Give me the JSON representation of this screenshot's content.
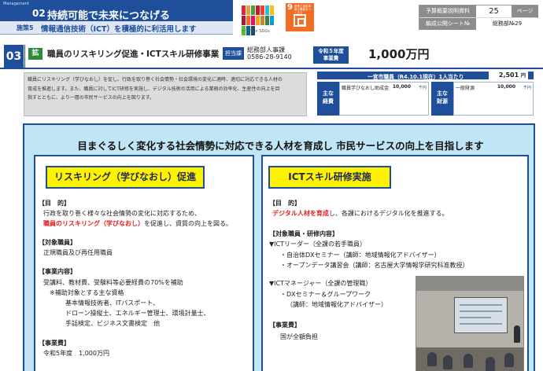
{
  "header": {
    "mgmt_label": "Management",
    "section_no": "02",
    "section_title": "持続可能で未来につなげる",
    "policy_no": "施策5",
    "policy_title": "情報通信技術（ICT）を積極的に利活用します",
    "sdgs_caption": "一宮市 × SDGs",
    "sdg_goal_no": "9",
    "sdg_goal_caption": "産業と技術革新の基盤をつくろう",
    "ref_label_1": "予算概要説明資料",
    "ref_page": "25",
    "ref_page_label": "ページ",
    "ref_label_2": "編成公開シート№",
    "ref_sheet": "総務部№29",
    "sdg_colors": [
      "#e5243b",
      "#dda63a",
      "#4c9f38",
      "#c5192d",
      "#ff3a21",
      "#26bde2",
      "#fcc30b",
      "#a21942",
      "#fd6925",
      "#dd1367",
      "#fd9d24",
      "#bf8b2e",
      "#3f7e44",
      "#0a97d9",
      "#56c02b",
      "#00689d",
      "#19486a"
    ]
  },
  "project": {
    "number": "03",
    "badge": "拡",
    "title": "職員のリスキリング促進・ICTスキル研修事業",
    "dept_label": "担当課",
    "dept_name": "総務部人事課",
    "dept_phone": "0586-28-9140",
    "fy_label_1": "令和５年度",
    "fy_label_2": "事業費",
    "budget": "1,000万円"
  },
  "description": {
    "line1": "職員にリスキリング（学びなおし）を促し、行政を取り巻く社会情勢・社会環境の変化に適時、適切に対応できる人材の",
    "line2": "育成を推進します。また、職員に対してICT研修を実施し、デジタル技術の活用による業務の効率化、生産性の向上を目",
    "line3": "指すとともに、より一層の市民サービスの向上を図ります。"
  },
  "finance": {
    "staff_label": "一宮市職員（R4.10.1現在）1人当たり",
    "staff_value": "2,501",
    "staff_unit": "円",
    "cost_label_1": "主な",
    "cost_label_2": "経費",
    "cost_item": "職員学びなおし助成金",
    "cost_value": "10,000",
    "unit": "千円",
    "source_label_1": "主な",
    "source_label_2": "財源",
    "source_item": "一般財源",
    "source_value": "10,000"
  },
  "main": {
    "headline": "目まぐるしく変化する社会情勢に対応できる人材を育成し 市民サービスの向上を目指します",
    "left": {
      "title": "リスキリング（学びなおし）促進",
      "purpose_head": "【目　的】",
      "purpose_1": "行政を取り巻く様々な社会情勢の変化に対応するため、",
      "purpose_2_red": "職員のリスキリング（学びなおし）",
      "purpose_2_rest": "を促進し、資質の向上を図る。",
      "target_head": "【対象職員】",
      "target_1": "正規職員及び再任用職員",
      "content_head": "【事業内容】",
      "content_1": "受講料、教材費、受験料等必要経費の70%を補助",
      "content_2": "※補助対象とする主な資格",
      "content_3": "基本情報技術者、ITパスポート、",
      "content_4": "ドローン操縦士、エネルギー管理士、環境計量士、",
      "content_5": "手話検定、ビジネス文書検定　他",
      "cost_head": "【事業費】",
      "cost_1": "令和5年度　1,000万円"
    },
    "right": {
      "title": "ICTスキル研修実施",
      "purpose_head": "【目　的】",
      "purpose_1_red": "デジタル人材を育成",
      "purpose_1_rest": "し、各課におけるデジタル化を推進する。",
      "target_head": "【対象職員・研修内容】",
      "target_1": "▼ICTリーダー（全課の若手職員）",
      "target_2": "・自治体DXセミナー（講師：地域情報化アドバイザー）",
      "target_3": "・オープンデータ講習会（講師：名古屋大学情報学研究科准教授）",
      "target_4": "▼ICTマネージャー（全課の管理職）",
      "target_5": "・DXセミナー＆グループワーク",
      "target_6": "（講師：地域情報化アドバイザー）",
      "cost_head": "【事業費】",
      "cost_1": "国が全額負担"
    }
  }
}
